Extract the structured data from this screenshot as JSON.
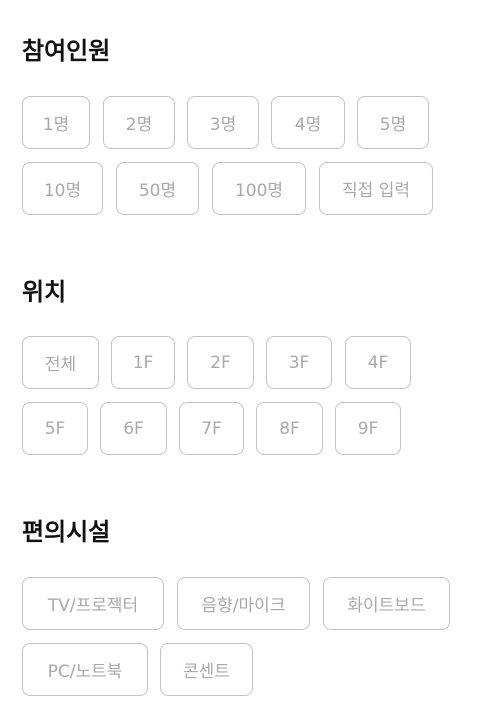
{
  "participants": {
    "title": "참여인원",
    "options": [
      "1명",
      "2명",
      "3명",
      "4명",
      "5명",
      "10명",
      "50명",
      "100명",
      "직접 입력"
    ]
  },
  "location": {
    "title": "위치",
    "options": [
      "전체",
      "1F",
      "2F",
      "3F",
      "4F",
      "5F",
      "6F",
      "7F",
      "8F",
      "9F"
    ]
  },
  "amenities": {
    "title": "편의시설",
    "options": [
      "TV/프로젝터",
      "음향/마이크",
      "화이트보드",
      "PC/노트북",
      "콘센트"
    ]
  }
}
